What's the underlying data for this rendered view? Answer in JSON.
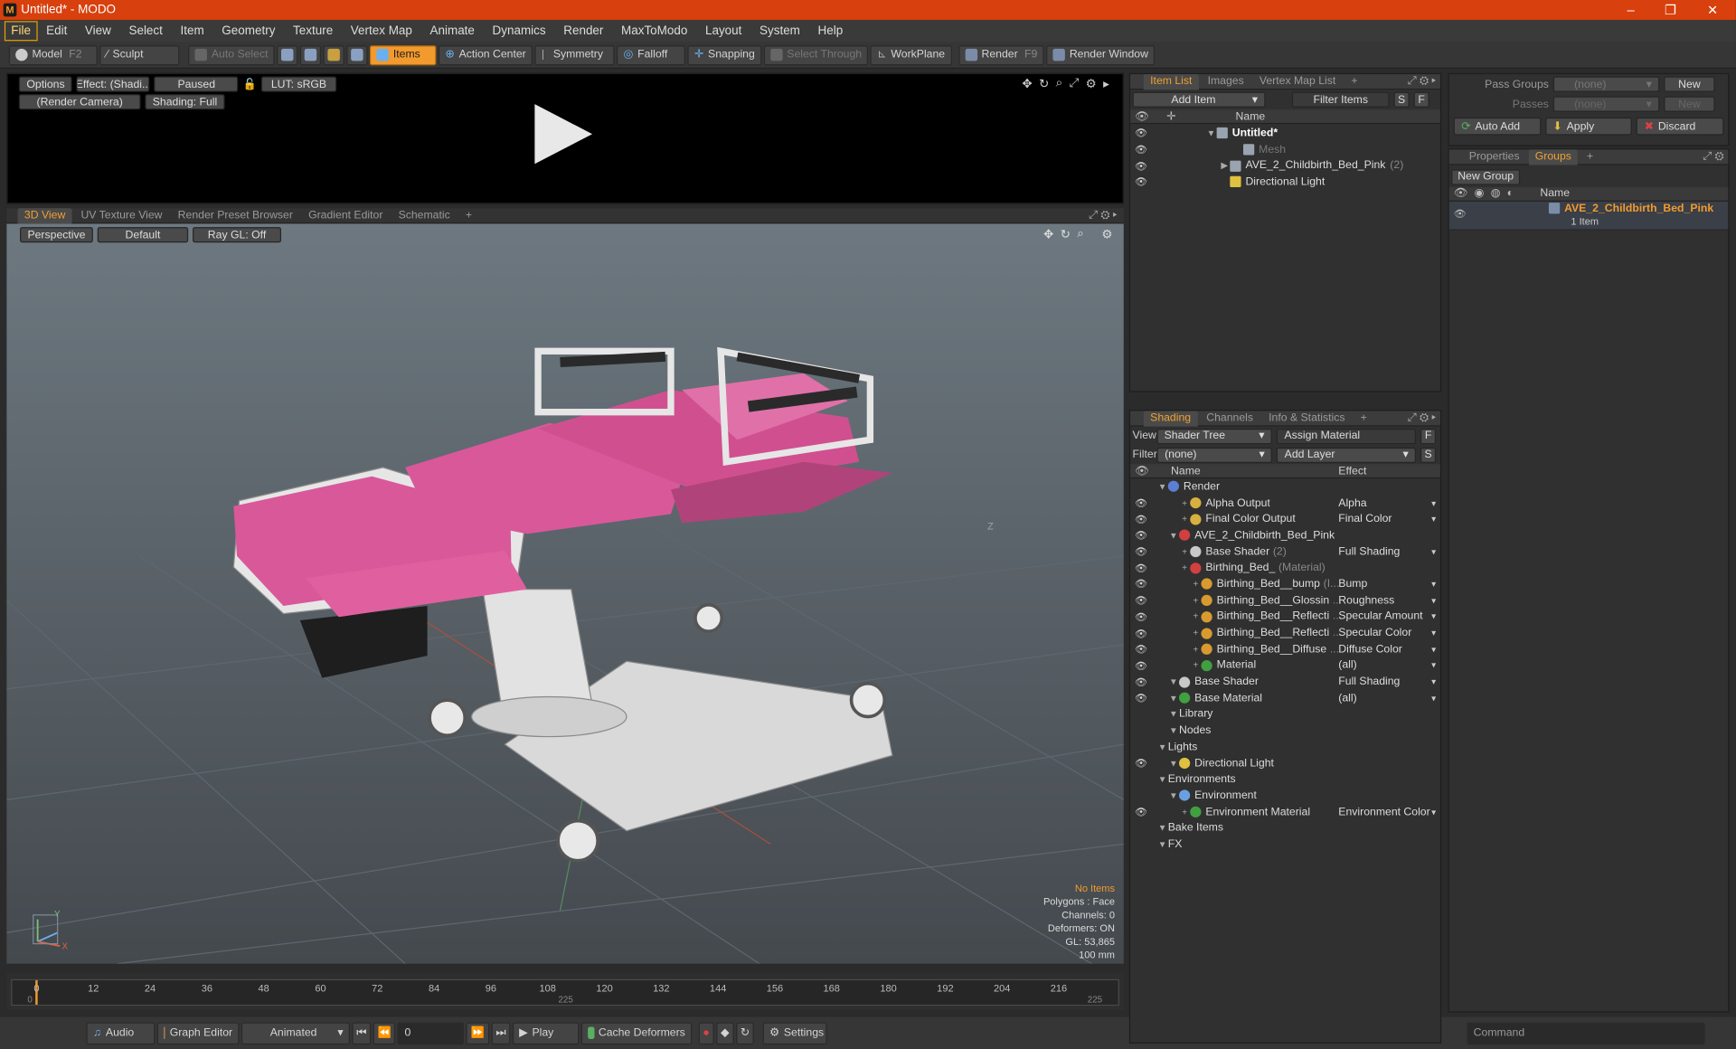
{
  "window": {
    "title": "Untitled* - MODO",
    "app_icon": "modo-logo-icon",
    "controls": [
      "–",
      "❐",
      "✕"
    ]
  },
  "menu": [
    "File",
    "Edit",
    "View",
    "Select",
    "Item",
    "Geometry",
    "Texture",
    "Vertex Map",
    "Animate",
    "Dynamics",
    "Render",
    "MaxToModo",
    "Layout",
    "System",
    "Help"
  ],
  "toolbar": {
    "model": "Model",
    "model_key": "F2",
    "sculpt": "Sculpt",
    "auto_select": "Auto Select",
    "items": "Items",
    "action_center": "Action Center",
    "symmetry": "Symmetry",
    "falloff": "Falloff",
    "snapping": "Snapping",
    "select_through": "Select Through",
    "workplane": "WorkPlane",
    "render": "Render",
    "render_key": "F9",
    "render_window": "Render Window"
  },
  "preview": {
    "options": "Options",
    "effect": "Effect: (Shadi...",
    "paused": "Paused",
    "lut": "LUT: sRGB",
    "camera": "(Render Camera)",
    "shading": "Shading: Full"
  },
  "view_tabs": [
    "3D View",
    "UV Texture View",
    "Render Preset Browser",
    "Gradient Editor",
    "Schematic"
  ],
  "viewport": {
    "perspective": "Perspective",
    "default": "Default",
    "raygl": "Ray GL: Off",
    "hud": [
      "No Items",
      "Polygons : Face",
      "Channels: 0",
      "Deformers: ON",
      "GL: 53,865",
      "100 mm"
    ],
    "axis_y": "Y",
    "axis_x": "X",
    "axis_z": "Z"
  },
  "timeline": {
    "major": [
      "0",
      "12",
      "24",
      "36",
      "48",
      "60",
      "72",
      "84",
      "96",
      "108",
      "120",
      "132",
      "144",
      "156",
      "168",
      "180",
      "192",
      "204",
      "216"
    ],
    "minor": [
      "0",
      "225",
      "225"
    ]
  },
  "bottom": {
    "audio": "Audio",
    "graph_editor": "Graph Editor",
    "animated": "Animated",
    "frame": "0",
    "play": "Play",
    "cache_deformers": "Cache Deformers",
    "settings": "Settings",
    "command": "Command"
  },
  "item_list": {
    "tabs": [
      "Item List",
      "Images",
      "Vertex Map List"
    ],
    "add_item": "Add Item",
    "filter_items": "Filter Items",
    "s": "S",
    "f": "F",
    "header_name": "Name",
    "rows": [
      {
        "label": "Untitled*",
        "extra": "",
        "indent": 0
      },
      {
        "label": "Mesh",
        "extra": "",
        "indent": 2
      },
      {
        "label": "AVE_2_Childbirth_Bed_Pink",
        "extra": "(2)",
        "indent": 1
      },
      {
        "label": "Directional Light",
        "extra": "",
        "indent": 1
      }
    ]
  },
  "shading": {
    "tabs": [
      "Shading",
      "Channels",
      "Info & Statistics"
    ],
    "view_label": "View",
    "view_value": "Shader Tree",
    "assign_material": "Assign Material",
    "filter_label": "Filter",
    "filter_value": "(none)",
    "add_layer": "Add Layer",
    "f": "F",
    "s": "S",
    "header_name": "Name",
    "header_effect": "Effect",
    "rows": [
      {
        "label": "Render",
        "note": "",
        "effect": "",
        "indent": 0,
        "icon": "#5b7fd4"
      },
      {
        "label": "Alpha Output",
        "note": "",
        "effect": "Alpha",
        "indent": 2,
        "icon": "#d8b040"
      },
      {
        "label": "Final Color Output",
        "note": "",
        "effect": "Final Color",
        "indent": 2,
        "icon": "#d8b040"
      },
      {
        "label": "AVE_2_Childbirth_Bed_Pink",
        "note": "",
        "effect": "",
        "indent": 1,
        "icon": "#d04040"
      },
      {
        "label": "Base Shader",
        "note": "(2)",
        "effect": "Full Shading",
        "indent": 2,
        "icon": "#c8c8c8"
      },
      {
        "label": "Birthing_Bed_",
        "note": "(Material)",
        "effect": "",
        "indent": 2,
        "icon": "#d04040"
      },
      {
        "label": "Birthing_Bed__bump",
        "note": "(I...",
        "effect": "Bump",
        "indent": 3,
        "icon": "#d89a30"
      },
      {
        "label": "Birthing_Bed__Glossin",
        "note": "...",
        "effect": "Roughness",
        "indent": 3,
        "icon": "#d89a30"
      },
      {
        "label": "Birthing_Bed__Reflecti",
        "note": "...",
        "effect": "Specular Amount",
        "indent": 3,
        "icon": "#d89a30"
      },
      {
        "label": "Birthing_Bed__Reflecti",
        "note": "...",
        "effect": "Specular Color",
        "indent": 3,
        "icon": "#d89a30"
      },
      {
        "label": "Birthing_Bed__Diffuse",
        "note": "...",
        "effect": "Diffuse Color",
        "indent": 3,
        "icon": "#d89a30"
      },
      {
        "label": "Material",
        "note": "",
        "effect": "(all)",
        "indent": 3,
        "icon": "#40a040"
      },
      {
        "label": "Base Shader",
        "note": "",
        "effect": "Full Shading",
        "indent": 1,
        "icon": "#c8c8c8"
      },
      {
        "label": "Base Material",
        "note": "",
        "effect": "(all)",
        "indent": 1,
        "icon": "#40a040"
      },
      {
        "label": "Library",
        "note": "",
        "effect": "",
        "indent": 1,
        "icon": ""
      },
      {
        "label": "Nodes",
        "note": "",
        "effect": "",
        "indent": 1,
        "icon": ""
      },
      {
        "label": "Lights",
        "note": "",
        "effect": "",
        "indent": 0,
        "icon": ""
      },
      {
        "label": "Directional Light",
        "note": "",
        "effect": "",
        "indent": 1,
        "icon": "#e0c040"
      },
      {
        "label": "Environments",
        "note": "",
        "effect": "",
        "indent": 0,
        "icon": ""
      },
      {
        "label": "Environment",
        "note": "",
        "effect": "",
        "indent": 1,
        "icon": "#6aa0e0"
      },
      {
        "label": "Environment Material",
        "note": "",
        "effect": "Environment Color",
        "indent": 2,
        "icon": "#40a040"
      },
      {
        "label": "Bake Items",
        "note": "",
        "effect": "",
        "indent": 0,
        "icon": ""
      },
      {
        "label": "FX",
        "note": "",
        "effect": "",
        "indent": 0,
        "icon": ""
      }
    ]
  },
  "groups": {
    "pass_groups_label": "Pass Groups",
    "pass_groups_value": "(none)",
    "new": "New",
    "passes_label": "Passes",
    "passes_value": "(none)",
    "new2": "New",
    "auto_add": "Auto Add",
    "apply": "Apply",
    "discard": "Discard",
    "tabs": [
      "Properties",
      "Groups"
    ],
    "new_group": "New Group",
    "header_name": "Name",
    "group_name": "AVE_2_Childbirth_Bed_Pink",
    "group_count": "1 Item"
  },
  "colors": {
    "accent": "#f29a2e",
    "title_bar": "#d8400d",
    "pink": "#d9589a"
  }
}
